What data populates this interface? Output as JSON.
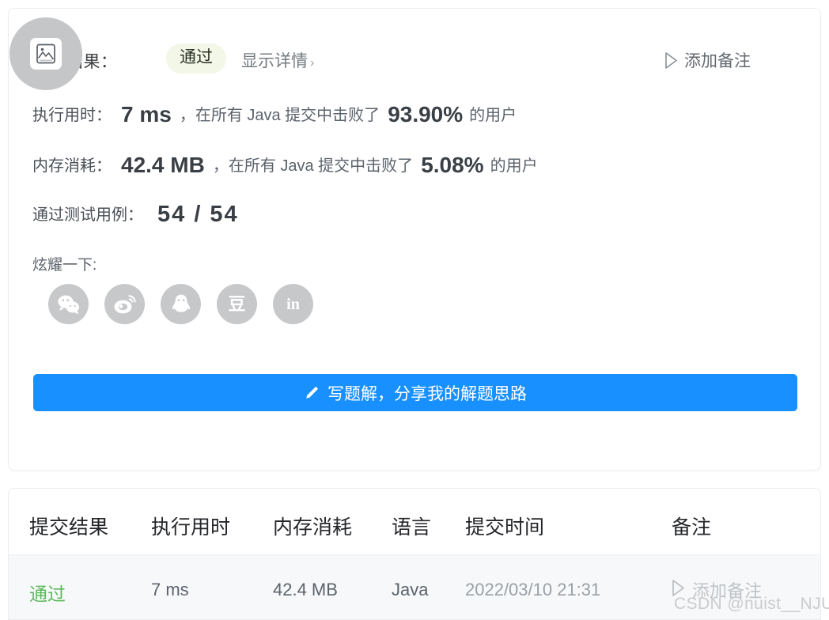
{
  "result_card": {
    "result_label": "执行结果：",
    "status_badge": "通过",
    "detail_link": "显示详情",
    "detail_chevron": "›",
    "add_note": "添加备注",
    "runtime": {
      "label": "执行用时：",
      "value": "7 ms",
      "middle": "，在所有 Java 提交中击败了",
      "percent": "93.90%",
      "suffix": "的用户"
    },
    "memory": {
      "label": "内存消耗：",
      "value": "42.4 MB",
      "middle": "，在所有 Java 提交中击败了",
      "percent": "5.08%",
      "suffix": "的用户"
    },
    "testcases": {
      "label": "通过测试用例：",
      "value": "54 / 54"
    },
    "share": {
      "title": "炫耀一下:",
      "items": [
        {
          "name": "wechat-share",
          "label": "微信"
        },
        {
          "name": "weibo-share",
          "label": "微博"
        },
        {
          "name": "qq-share",
          "label": "QQ"
        },
        {
          "name": "douban-share",
          "label": "豆"
        },
        {
          "name": "linkedin-share",
          "label": "in"
        }
      ]
    },
    "write_button": "写题解，分享我的解题思路"
  },
  "submissions_table": {
    "headers": [
      "提交结果",
      "执行用时",
      "内存消耗",
      "语言",
      "提交时间",
      "备注"
    ],
    "rows": [
      {
        "result": "通过",
        "runtime": "7 ms",
        "memory": "42.4 MB",
        "language": "Java",
        "submitted_at": "2022/03/10 21:31",
        "note": "添加备注"
      }
    ]
  },
  "overlay": {
    "watermark": "CSDN @nuist__NJUPT"
  },
  "colors": {
    "primary_blue": "#1890ff",
    "pass_green": "#5cb85c",
    "badge_bg": "#f2f7e8",
    "row_bg": "#f7f8f9",
    "text_main": "#3c3f41",
    "text_muted": "#9aa0a6"
  }
}
